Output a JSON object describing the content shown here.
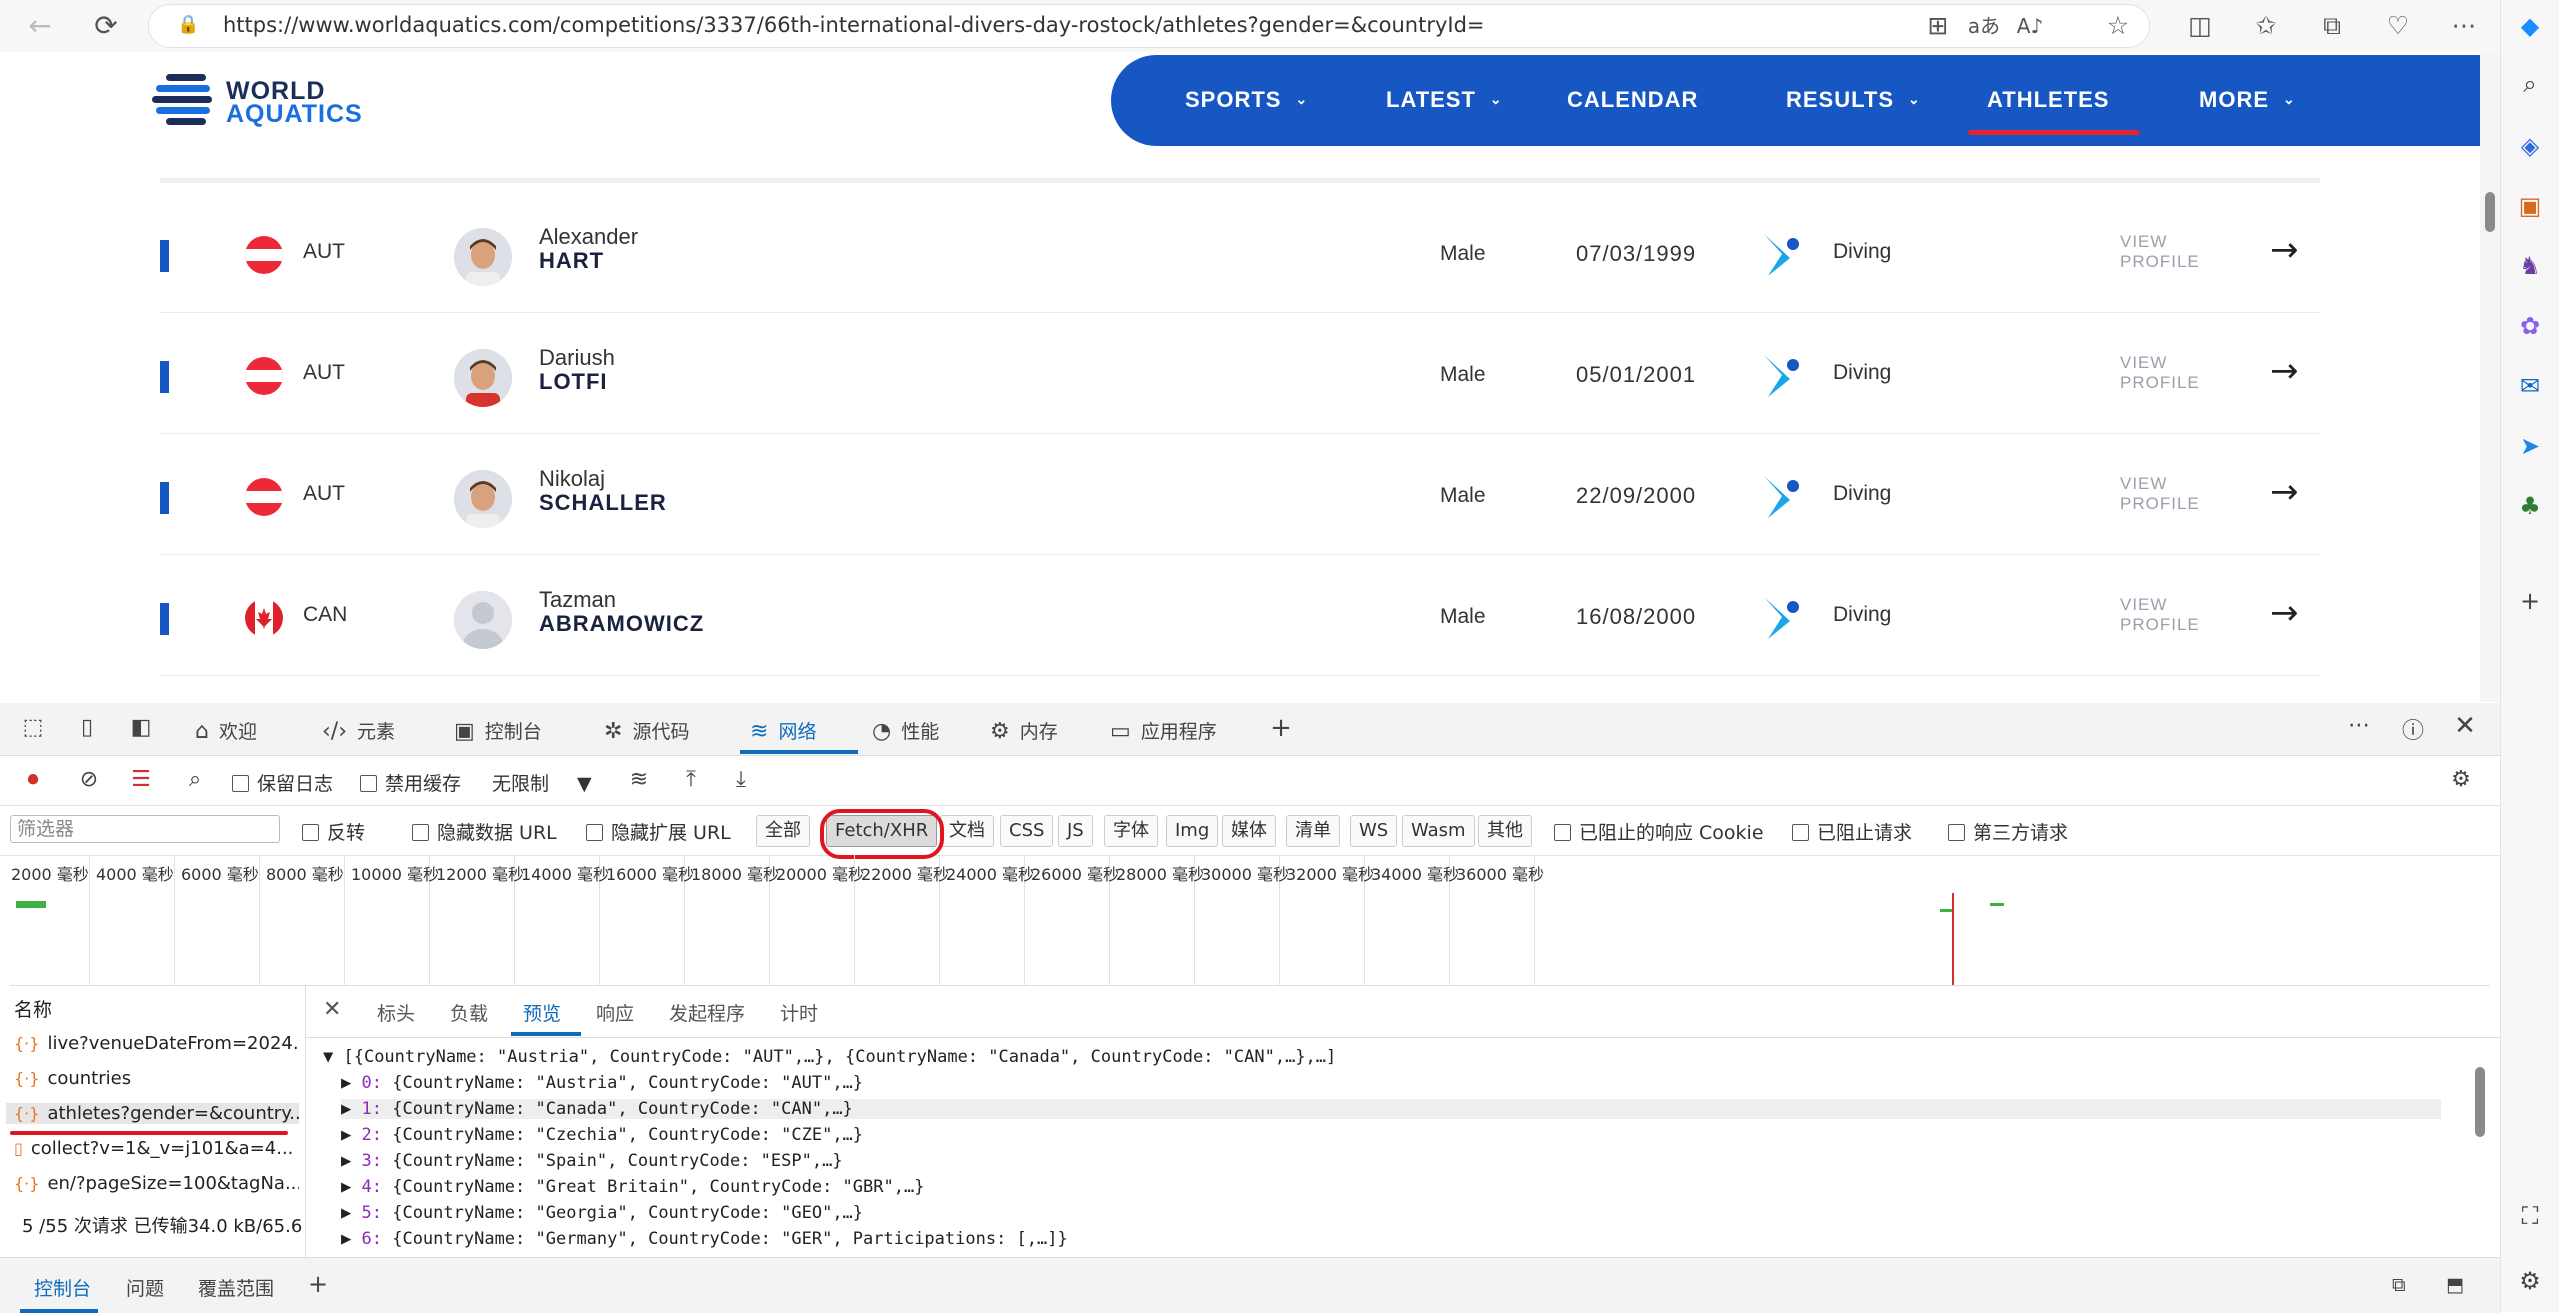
{
  "browser": {
    "url": "https://www.worldaquatics.com/competitions/3337/66th-international-divers-day-rostock/athletes?gender=&countryId=",
    "back_icon": "back-arrow-icon",
    "reload_icon": "reload-icon"
  },
  "site": {
    "logo_line1": "WORLD",
    "logo_line2": "AQUATICS",
    "nav": [
      "SPORTS",
      "LATEST",
      "CALENDAR",
      "RESULTS",
      "ATHLETES",
      "MORE"
    ],
    "active_nav": "ATHLETES"
  },
  "athletes": [
    {
      "code": "AUT",
      "first": "Alexander",
      "last": "HART",
      "gender": "Male",
      "dob": "07/03/1999",
      "sport": "Diving",
      "view": [
        "VIEW",
        "PROFILE"
      ]
    },
    {
      "code": "AUT",
      "first": "Dariush",
      "last": "LOTFI",
      "gender": "Male",
      "dob": "05/01/2001",
      "sport": "Diving",
      "view": [
        "VIEW",
        "PROFILE"
      ]
    },
    {
      "code": "AUT",
      "first": "Nikolaj",
      "last": "SCHALLER",
      "gender": "Male",
      "dob": "22/09/2000",
      "sport": "Diving",
      "view": [
        "VIEW",
        "PROFILE"
      ]
    },
    {
      "code": "CAN",
      "first": "Tazman",
      "last": "ABRAMOWICZ",
      "gender": "Male",
      "dob": "16/08/2000",
      "sport": "Diving",
      "view": [
        "VIEW",
        "PROFILE"
      ]
    }
  ],
  "devtools": {
    "tabs": [
      "欢迎",
      "元素",
      "控制台",
      "源代码",
      "网络",
      "性能",
      "内存",
      "应用程序"
    ],
    "active_tab": "网络",
    "toolbar1": {
      "preserve_log": "保留日志",
      "disable_cache": "禁用缓存",
      "throttle": "无限制"
    },
    "toolbar2": {
      "filter_placeholder": "筛选器",
      "invert": "反转",
      "hide_data_url": "隐藏数据 URL",
      "hide_ext_url": "隐藏扩展 URL",
      "types": [
        "全部",
        "Fetch/XHR",
        "文档",
        "CSS",
        "JS",
        "字体",
        "Img",
        "媒体",
        "清单",
        "WS",
        "Wasm",
        "其他"
      ],
      "active_type": "Fetch/XHR",
      "blocked_cookies": "已阻止的响应 Cookie",
      "blocked_requests": "已阻止请求",
      "third_party": "第三方请求"
    },
    "timeline_ticks": [
      "2000 毫秒",
      "4000 毫秒",
      "6000 毫秒",
      "8000 毫秒",
      "10000 毫秒",
      "12000 毫秒",
      "14000 毫秒",
      "16000 毫秒",
      "18000 毫秒",
      "20000 毫秒",
      "22000 毫秒",
      "24000 毫秒",
      "26000 毫秒",
      "28000 毫秒",
      "30000 毫秒",
      "32000 毫秒",
      "34000 毫秒",
      "36000 毫秒"
    ],
    "name_header": "名称",
    "requests": [
      "live?venueDateFrom=2024...",
      "countries",
      "athletes?gender=&country...",
      "collect?v=1&_v=j101&a=4...",
      "en/?pageSize=100&tagNa..."
    ],
    "selected_request": "athletes?gender=&country...",
    "status": "5 /55 次请求  已传输34.0 kB/65.6",
    "detail_tabs": [
      "标头",
      "负载",
      "预览",
      "响应",
      "发起程序",
      "计时"
    ],
    "active_detail_tab": "预览",
    "preview_summary": "[{CountryName: \"Austria\", CountryCode: \"AUT\",…}, {CountryName: \"Canada\", CountryCode: \"CAN\",…},…]",
    "preview_items": [
      {
        "idx": "0:",
        "text": "{CountryName: \"Austria\", CountryCode: \"AUT\",…}"
      },
      {
        "idx": "1:",
        "text": "{CountryName: \"Canada\", CountryCode: \"CAN\",…}"
      },
      {
        "idx": "2:",
        "text": "{CountryName: \"Czechia\", CountryCode: \"CZE\",…}"
      },
      {
        "idx": "3:",
        "text": "{CountryName: \"Spain\", CountryCode: \"ESP\",…}"
      },
      {
        "idx": "4:",
        "text": "{CountryName: \"Great Britain\", CountryCode: \"GBR\",…}"
      },
      {
        "idx": "5:",
        "text": "{CountryName: \"Georgia\", CountryCode: \"GEO\",…}"
      },
      {
        "idx": "6:",
        "text": "{CountryName: \"Germany\", CountryCode: \"GER\", Participations: [,…]}"
      }
    ],
    "bottom_tabs": [
      "控制台",
      "问题",
      "覆盖范围"
    ]
  },
  "colors": {
    "nav_blue": "#1657c4",
    "accent_red": "#e5222f",
    "devtools_blue": "#0f6cbd"
  }
}
